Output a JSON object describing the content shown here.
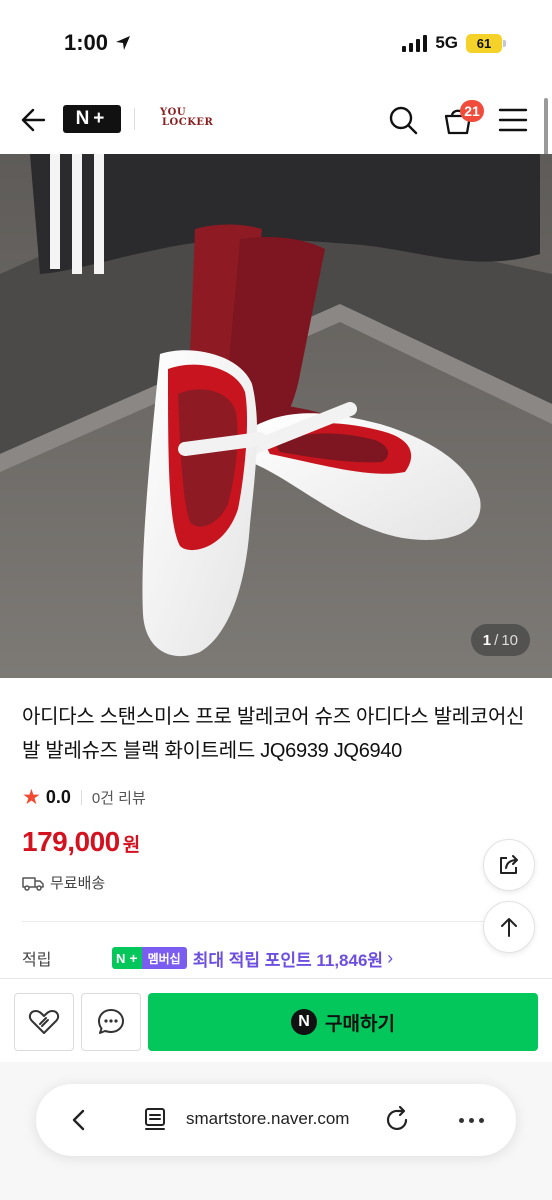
{
  "status_bar": {
    "time": "1:00",
    "network": "5G",
    "battery": "61"
  },
  "header": {
    "logo_text": "N+",
    "brand_line1": "YOU",
    "brand_line2": "LOCKER",
    "cart_count": "21"
  },
  "gallery": {
    "current": "1",
    "separator": "/",
    "total": "10"
  },
  "product": {
    "title": "아디다스 스탠스미스 프로 발레코어 슈즈 아디다스 발레코어신발 발레슈즈 블랙 화이트레드 JQ6939 JQ6940",
    "rating": "0.0",
    "review_count": "0건 리뷰",
    "price": "179,000",
    "price_unit": "원",
    "shipping": "무료배송",
    "points_label": "적립",
    "membership_n": "N",
    "membership_plus": "+",
    "membership_label": "멤버십",
    "points_text": "최대 적립 포인트 11,846원",
    "accent_color": "#d4121f",
    "membership_color": "#6d4fe0"
  },
  "actions": {
    "buy_icon": "N",
    "buy_label": "구매하기",
    "buy_color": "#03c75a"
  },
  "browser": {
    "url": "smartstore.naver.com"
  },
  "icons": [
    "back-arrow-icon",
    "search-icon",
    "cart-icon",
    "hamburger-menu-icon",
    "share-icon",
    "arrow-up-icon",
    "heart-icon",
    "chat-icon",
    "reader-icon",
    "reload-icon",
    "more-icon",
    "truck-icon",
    "star-icon",
    "location-arrow-icon"
  ]
}
